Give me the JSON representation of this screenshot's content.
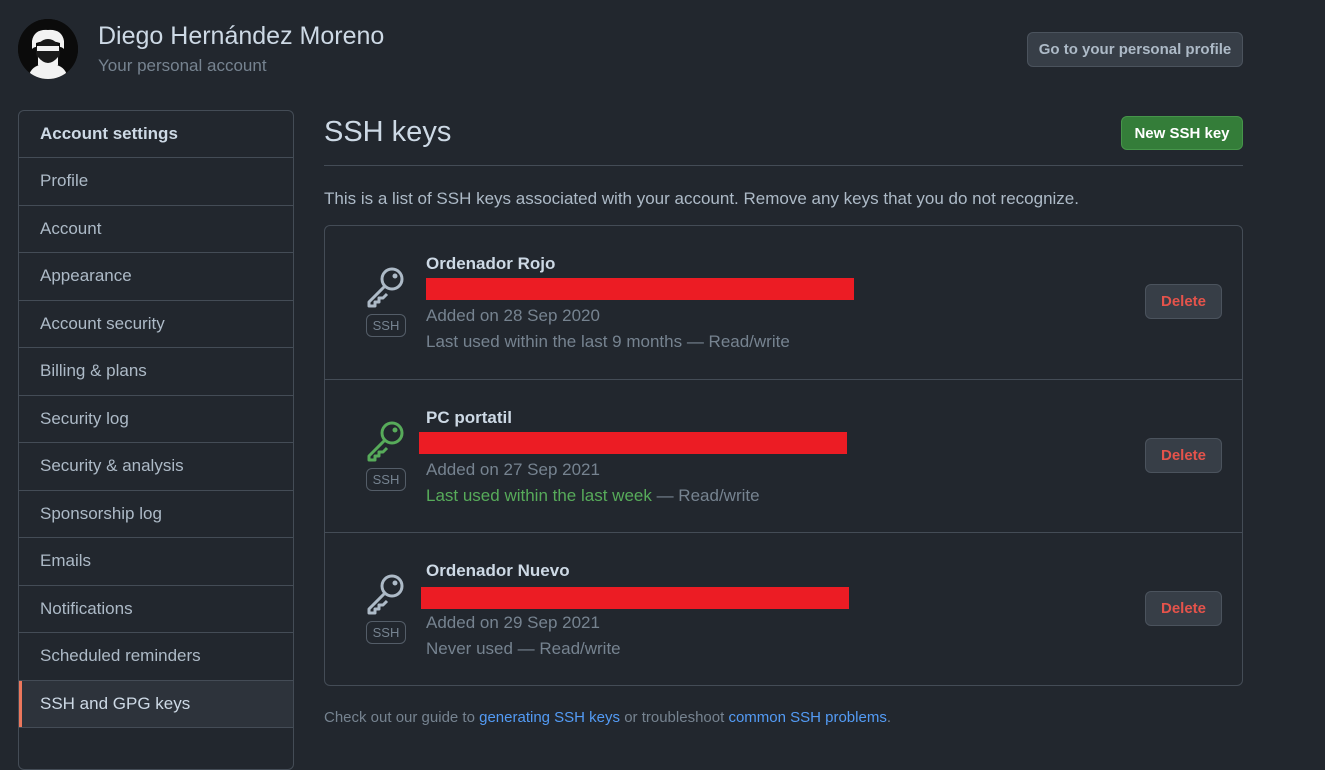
{
  "header": {
    "user_name": "Diego Hernández Moreno",
    "account_type": "Your personal account",
    "profile_button": "Go to your personal profile"
  },
  "sidebar": {
    "heading": "Account settings",
    "items": [
      {
        "label": "Profile",
        "active": false
      },
      {
        "label": "Account",
        "active": false
      },
      {
        "label": "Appearance",
        "active": false
      },
      {
        "label": "Account security",
        "active": false
      },
      {
        "label": "Billing & plans",
        "active": false
      },
      {
        "label": "Security log",
        "active": false
      },
      {
        "label": "Security & analysis",
        "active": false
      },
      {
        "label": "Sponsorship log",
        "active": false
      },
      {
        "label": "Emails",
        "active": false
      },
      {
        "label": "Notifications",
        "active": false
      },
      {
        "label": "Scheduled reminders",
        "active": false
      },
      {
        "label": "SSH and GPG keys",
        "active": true
      }
    ]
  },
  "main": {
    "title": "SSH keys",
    "new_key_button": "New SSH key",
    "intro": "This is a list of SSH keys associated with your account. Remove any keys that you do not recognize.",
    "keys": [
      {
        "title": "Ordenador Rojo",
        "badge": "SSH",
        "added": "Added on 28 Sep 2020",
        "last_used": "Last used within the last 9 months",
        "access": " — Read/write",
        "recent": false,
        "icon": "key-icon",
        "delete_label": "Delete"
      },
      {
        "title": "PC portatil",
        "badge": "SSH",
        "added": "Added on 27 Sep 2021",
        "last_used": "Last used within the last week",
        "access": " — Read/write",
        "recent": true,
        "icon": "key-icon",
        "delete_label": "Delete"
      },
      {
        "title": "Ordenador Nuevo",
        "badge": "SSH",
        "added": "Added on 29 Sep 2021",
        "last_used": "Never used",
        "access": " — Read/write",
        "recent": false,
        "icon": "key-icon",
        "delete_label": "Delete"
      }
    ],
    "footer": {
      "prefix": "Check out our guide to ",
      "link1": "generating SSH keys",
      "middle": " or troubleshoot ",
      "link2": "common SSH problems",
      "suffix": "."
    }
  },
  "colors": {
    "background": "#22272e",
    "primary_button": "#347d39",
    "danger": "#e5534b",
    "active_accent": "#ec775c",
    "link": "#539bf5",
    "recent_key": "#57ab5a",
    "redaction": "#ec1c24"
  }
}
